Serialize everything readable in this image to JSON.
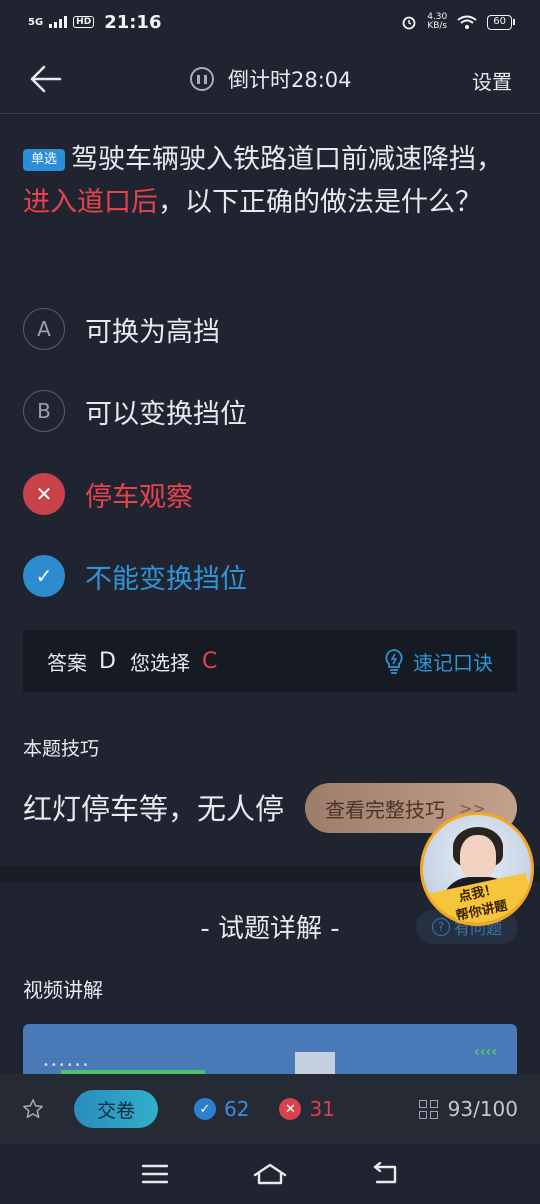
{
  "status_bar": {
    "network": "5G",
    "hd": "HD",
    "time": "21:16",
    "speed": "4.30",
    "speed_unit": "KB/s",
    "battery": "60"
  },
  "header": {
    "timer_label": "倒计时28:04",
    "settings": "设置"
  },
  "question": {
    "tag": "单选",
    "text_before": "驾驶车辆驶入铁路道口前减速降挡，",
    "highlight": "进入道口后",
    "text_after": "，以下正确的做法是什么？"
  },
  "options": [
    {
      "marker": "A",
      "text": "可换为高挡",
      "state": "normal"
    },
    {
      "marker": "B",
      "text": "可以变换挡位",
      "state": "normal"
    },
    {
      "marker": "✕",
      "text": "停车观察",
      "state": "wrong"
    },
    {
      "marker": "✓",
      "text": "不能变换挡位",
      "state": "correct"
    }
  ],
  "answer": {
    "answer_label": "答案",
    "answer_value": "D",
    "choice_label": "您选择",
    "choice_value": "C",
    "memo_label": "速记口诀"
  },
  "tips": {
    "title": "本题技巧",
    "text": "红灯停车等，无人停",
    "fade": "",
    "view_all": "查看完整技巧",
    "view_all_chevron": ">>"
  },
  "helper": {
    "line1": "点我！",
    "line2": "帮你讲题"
  },
  "detail": {
    "title": "- 试题详解 -",
    "ask": "有问题",
    "video_title": "视频讲解"
  },
  "bottom": {
    "submit": "交卷",
    "correct_count": "62",
    "wrong_count": "31",
    "progress": "93/100"
  }
}
